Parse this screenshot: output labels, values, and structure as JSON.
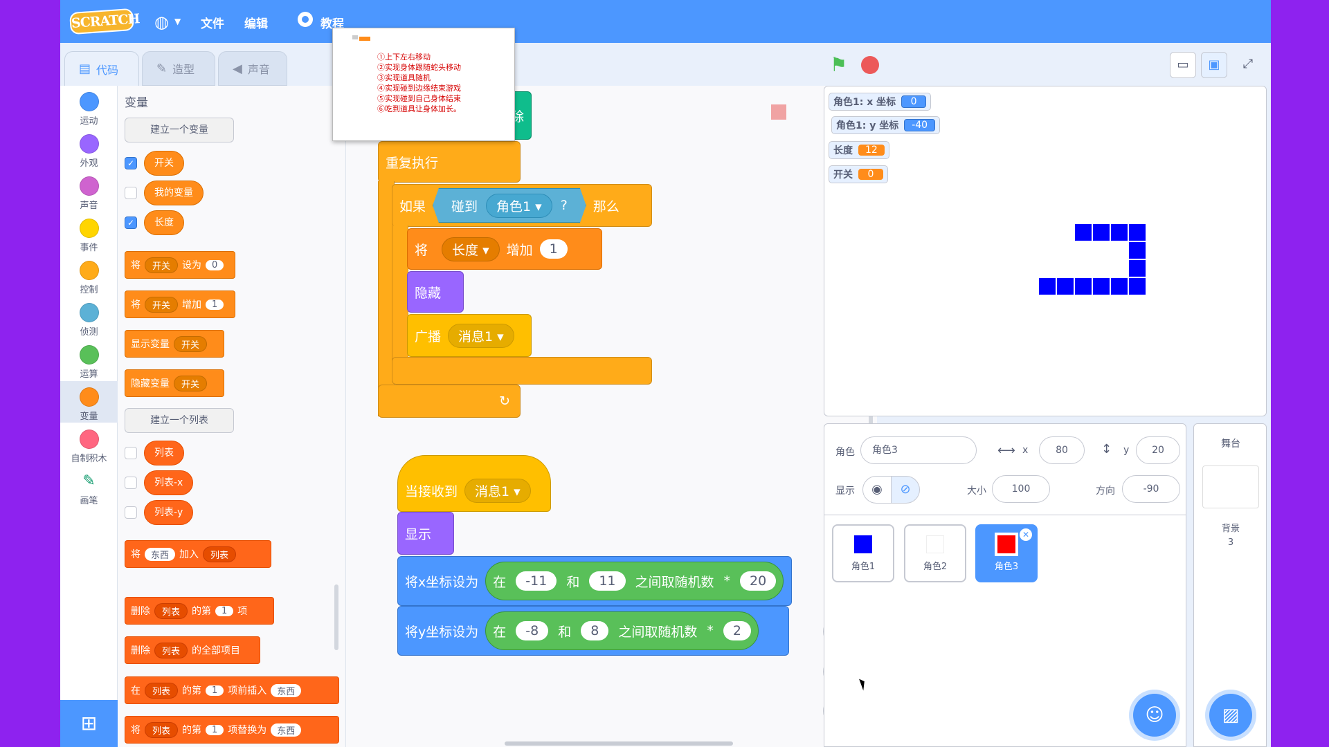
{
  "menubar": {
    "logo": "SCRATCH",
    "items": [
      "文件",
      "编辑"
    ],
    "tutorial": "教程"
  },
  "tabs": [
    "代码",
    "造型",
    "声音"
  ],
  "categories": [
    {
      "label": "运动",
      "color": "#4c97ff"
    },
    {
      "label": "外观",
      "color": "#9966ff"
    },
    {
      "label": "声音",
      "color": "#cf63cf"
    },
    {
      "label": "事件",
      "color": "#ffd500"
    },
    {
      "label": "控制",
      "color": "#ffab19"
    },
    {
      "label": "侦测",
      "color": "#5cb1d6"
    },
    {
      "label": "运算",
      "color": "#59c059"
    },
    {
      "label": "变量",
      "color": "#ff8c1a"
    },
    {
      "label": "自制积木",
      "color": "#ff6680"
    },
    {
      "label": "画笔",
      "color": "#0fbd8c"
    }
  ],
  "palette": {
    "title": "变量",
    "make_var": "建立一个变量",
    "variables": [
      "开关",
      "我的变量",
      "长度"
    ],
    "blocks": {
      "set": {
        "a": "将",
        "var": "开关",
        "b": "设为",
        "val": "0"
      },
      "change": {
        "a": "将",
        "var": "开关",
        "b": "增加",
        "val": "1"
      },
      "show": {
        "a": "显示变量",
        "var": "开关"
      },
      "hide": {
        "a": "隐藏变量",
        "var": "开关"
      }
    },
    "make_list": "建立一个列表",
    "lists": [
      "列表",
      "列表-x",
      "列表-y"
    ],
    "list_blocks": {
      "add": {
        "a": "将",
        "item": "东西",
        "b": "加入",
        "list": "列表"
      },
      "delete": {
        "a": "删除",
        "list": "列表",
        "b": "的第",
        "idx": "1",
        "c": "项"
      },
      "delete_all": {
        "a": "删除",
        "list": "列表",
        "b": "的全部项目"
      },
      "insert": {
        "a": "在",
        "list": "列表",
        "b": "的第",
        "idx": "1",
        "c": "项前插入",
        "item": "东西"
      },
      "replace": {
        "a": "将",
        "list": "列表",
        "b": "的第",
        "idx": "1",
        "c": "项替换为",
        "item": "东西"
      }
    }
  },
  "thumbnail": {
    "lines": "①上下左右移动\n②实现身体跟随蛇头移动\n③实现道具随机\n④实现碰到边缘结束游戏\n⑤实现碰到自己身体结束\n⑥吃到道具让身体加长。"
  },
  "script1": {
    "erase_tail": "部擦除",
    "forever": "重复执行",
    "if": "如果",
    "touching": "碰到",
    "touching_target": "角色1",
    "q": "?",
    "then": "那么",
    "change_a": "将",
    "change_var": "长度",
    "change_b": "增加",
    "change_val": "1",
    "hide": "隐藏",
    "broadcast": "广播",
    "broadcast_msg": "消息1",
    "loop_arrow": "↻"
  },
  "script2": {
    "when_receive": "当接收到",
    "msg": "消息1",
    "show": "显示",
    "setx": "将x坐标设为",
    "sety": "将y坐标设为",
    "in": "在",
    "and": "和",
    "random": "之间取随机数",
    "times": "*",
    "x_min": "-11",
    "x_max": "11",
    "x_mult": "20",
    "y_min": "-8",
    "y_max": "8",
    "y_mult": "2"
  },
  "zoom": {
    "in": "⊕",
    "out": "⊖",
    "reset": "="
  },
  "monitors": [
    {
      "label": "角色1: x 坐标",
      "value": "0",
      "color": "blue"
    },
    {
      "label": "角色1: y 坐标",
      "value": "-40",
      "color": "blue"
    },
    {
      "label": "长度",
      "value": "12",
      "color": "orange"
    },
    {
      "label": "开关",
      "value": "0",
      "color": "orange"
    }
  ],
  "sprite_info": {
    "sprite_label": "角色",
    "sprite_name": "角色3",
    "x_label": "x",
    "x": "80",
    "y_label": "y",
    "y": "20",
    "show_label": "显示",
    "size_label": "大小",
    "size": "100",
    "dir_label": "方向",
    "dir": "-90"
  },
  "sprites": [
    {
      "name": "角色1",
      "color": "#0000ff"
    },
    {
      "name": "角色2",
      "color": "#ffffff"
    },
    {
      "name": "角色3",
      "color": "#ff0000"
    }
  ],
  "stage_panel": {
    "title": "舞台",
    "backdrop_label": "背景",
    "backdrop_count": "3"
  }
}
